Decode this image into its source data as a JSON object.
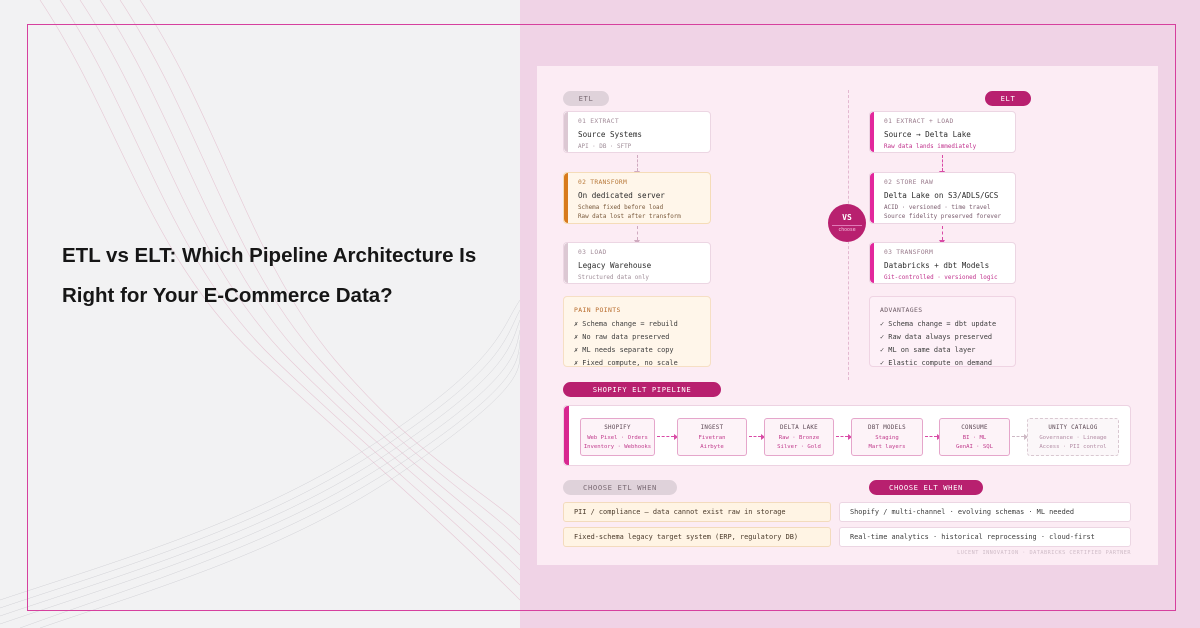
{
  "headline": {
    "line1": "ETL vs ELT: Which Pipeline Architecture Is",
    "line2": "Right for Your E-Commerce Data?"
  },
  "etl": {
    "tag": "ETL",
    "steps": [
      {
        "step": "01 EXTRACT",
        "title": "Source Systems",
        "sub": [
          "API · DB · SFTP"
        ]
      },
      {
        "step": "02 TRANSFORM",
        "title": "On dedicated server",
        "sub": [
          "Schema fixed before load",
          "Raw data lost after transform"
        ]
      },
      {
        "step": "03 LOAD",
        "title": "Legacy Warehouse",
        "sub": [
          "Structured data only"
        ]
      }
    ],
    "pain_points": {
      "heading": "PAIN POINTS",
      "items": [
        "✗ Schema change = rebuild",
        "✗ No raw data preserved",
        "✗ ML needs separate copy",
        "✗ Fixed compute, no scale"
      ]
    }
  },
  "elt": {
    "tag": "ELT",
    "steps": [
      {
        "step": "01 EXTRACT + LOAD",
        "title": "Source → Delta Lake",
        "sub": [
          "Raw data lands immediately"
        ]
      },
      {
        "step": "02 STORE RAW",
        "title": "Delta Lake on S3/ADLS/GCS",
        "sub": [
          "ACID · versioned · time travel",
          "Source fidelity preserved forever"
        ]
      },
      {
        "step": "03 TRANSFORM",
        "title": "Databricks + dbt Models",
        "sub": [
          "Git-controlled · versioned logic"
        ]
      }
    ],
    "advantages": {
      "heading": "ADVANTAGES",
      "items": [
        "✓ Schema change = dbt update",
        "✓ Raw data always preserved",
        "✓ ML on same data layer",
        "✓ Elastic compute on demand"
      ]
    }
  },
  "vs": {
    "label": "VS",
    "sub": "choose"
  },
  "pipeline": {
    "tag": "SHOPIFY ELT PIPELINE",
    "nodes": [
      {
        "title": "SHOPIFY",
        "line1": "Web Pixel · Orders",
        "line2": "Inventory · Webhooks"
      },
      {
        "title": "INGEST",
        "line1": "Fivetran",
        "line2": "Airbyte"
      },
      {
        "title": "DELTA LAKE",
        "line1": "Raw · Bronze",
        "line2": "Silver · Gold"
      },
      {
        "title": "DBT MODELS",
        "line1": "Staging",
        "line2": "Mart layers"
      },
      {
        "title": "CONSUME",
        "line1": "BI · ML",
        "line2": "GenAI · SQL"
      },
      {
        "title": "UNITY CATALOG",
        "line1": "Governance · Lineage",
        "line2": "Access · PII control"
      }
    ]
  },
  "choose": {
    "etl_tag": "CHOOSE ETL WHEN",
    "elt_tag": "CHOOSE ELT WHEN",
    "etl_rows": [
      "PII / compliance — data cannot exist raw in storage",
      "Fixed-schema legacy target system (ERP, regulatory DB)"
    ],
    "elt_rows": [
      "Shopify / multi-channel · evolving schemas · ML needed",
      "Real-time analytics · historical reprocessing · cloud-first"
    ]
  },
  "footer": "LUCENT INNOVATION · DATABRICKS CERTIFIED PARTNER",
  "colors": {
    "accent": "#b8206f",
    "pink": "#d82790",
    "warm": "#d87a1c",
    "frame": "#d6409e"
  }
}
